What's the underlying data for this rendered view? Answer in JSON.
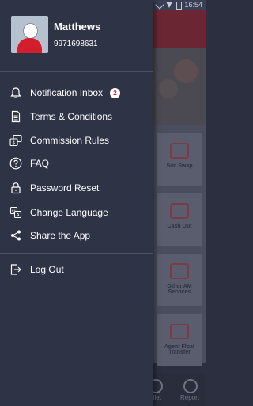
{
  "status_bar": {
    "time": "16:54"
  },
  "user": {
    "name": "Matthews",
    "phone": "9971698631"
  },
  "menu": {
    "items": [
      {
        "label": "Notification Inbox",
        "icon": "bell-icon",
        "badge": "2"
      },
      {
        "label": "Terms & Conditions",
        "icon": "document-icon"
      },
      {
        "label": "Commission Rules",
        "icon": "commission-icon"
      },
      {
        "label": "FAQ",
        "icon": "question-icon"
      },
      {
        "label": "Password Reset",
        "icon": "lock-icon"
      },
      {
        "label": "Change Language",
        "icon": "language-icon"
      },
      {
        "label": "Share the App",
        "icon": "share-icon"
      }
    ],
    "logout": {
      "label": "Log Out",
      "icon": "logout-icon"
    }
  },
  "background": {
    "tiles": [
      "Sim Swap",
      "Cash Out",
      "Other AM Services",
      "Agent Float Transfer"
    ],
    "bottom_nav": [
      "Wallet",
      "Report"
    ]
  },
  "colors": {
    "accent": "#d31f2b",
    "drawer": "#2e3346",
    "text": "#ffffff"
  }
}
